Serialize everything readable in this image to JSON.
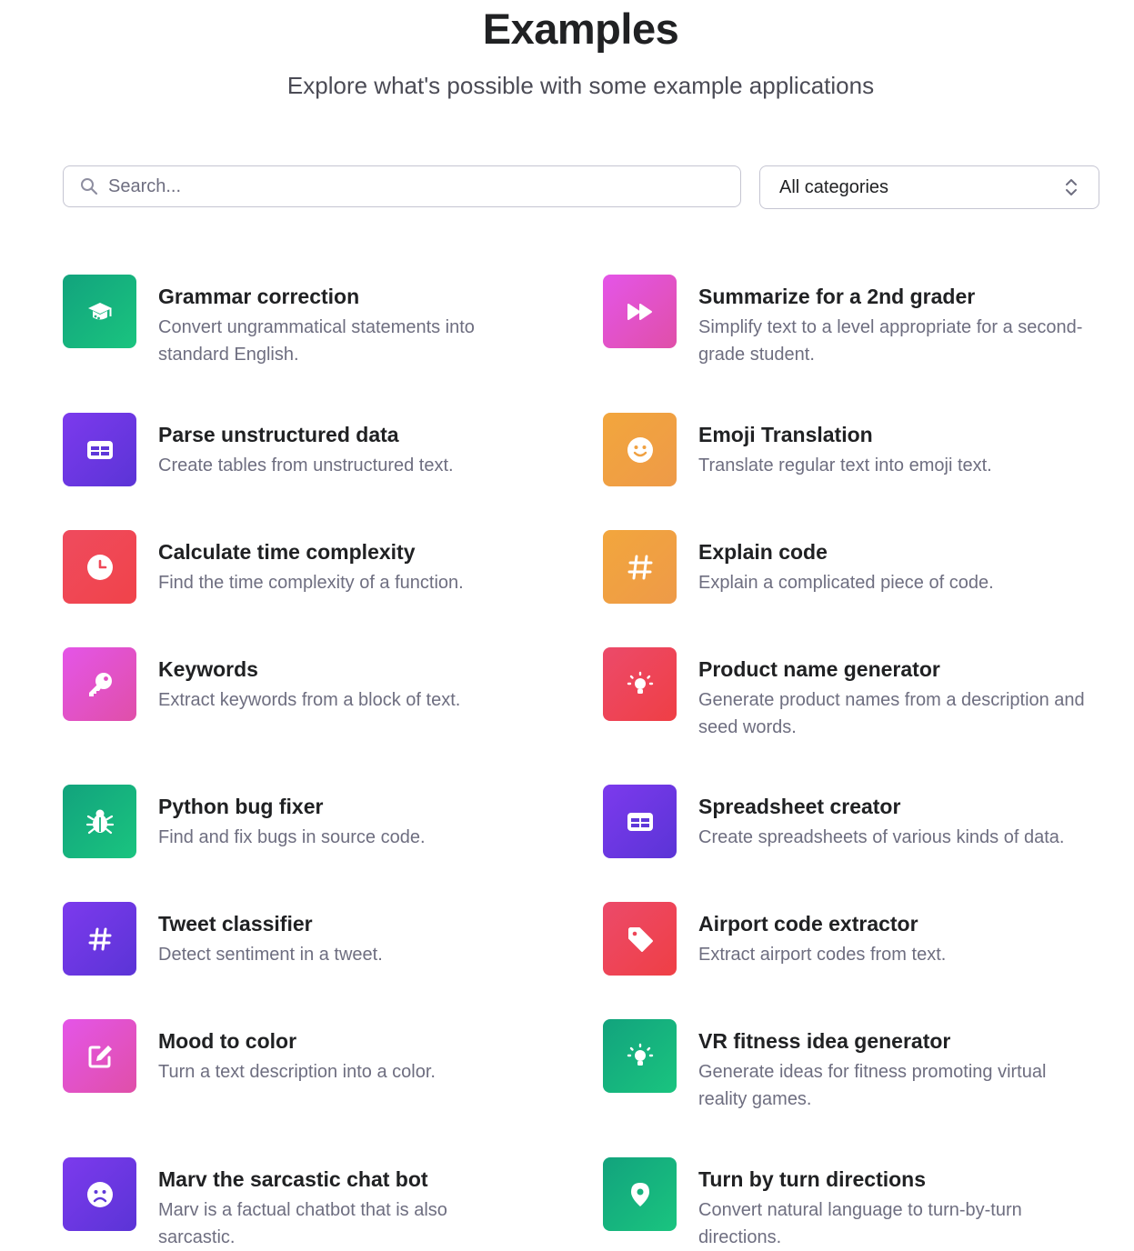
{
  "header": {
    "title": "Examples",
    "subtitle": "Explore what's possible with some example applications"
  },
  "search": {
    "placeholder": "Search...",
    "value": ""
  },
  "category_select": {
    "selected": "All categories"
  },
  "colors": {
    "green": "#1ac47f",
    "pink": "#e455e8",
    "purple": "#5b34d6",
    "orange": "#f2a63d",
    "red": "#f0434a",
    "text_primary": "#202123",
    "text_secondary": "#6e6e80"
  },
  "examples": [
    {
      "title": "Grammar correction",
      "desc": "Convert ungrammatical statements into standard English.",
      "icon": "graduation-cap-icon"
    },
    {
      "title": "Summarize for a 2nd grader",
      "desc": "Simplify text to a level appropriate for a second-grade student.",
      "icon": "fast-forward-icon"
    },
    {
      "title": "Parse unstructured data",
      "desc": "Create tables from unstructured text.",
      "icon": "table-icon"
    },
    {
      "title": "Emoji Translation",
      "desc": "Translate regular text into emoji text.",
      "icon": "smiley-icon"
    },
    {
      "title": "Calculate time complexity",
      "desc": "Find the time complexity of a function.",
      "icon": "clock-icon"
    },
    {
      "title": "Explain code",
      "desc": "Explain a complicated piece of code.",
      "icon": "hashtag-icon"
    },
    {
      "title": "Keywords",
      "desc": "Extract keywords from a block of text.",
      "icon": "key-icon"
    },
    {
      "title": "Product name generator",
      "desc": "Generate product names from a description and seed words.",
      "icon": "lightbulb-icon"
    },
    {
      "title": "Python bug fixer",
      "desc": "Find and fix bugs in source code.",
      "icon": "bug-icon"
    },
    {
      "title": "Spreadsheet creator",
      "desc": "Create spreadsheets of various kinds of data.",
      "icon": "table-icon"
    },
    {
      "title": "Tweet classifier",
      "desc": "Detect sentiment in a tweet.",
      "icon": "hashtag-icon"
    },
    {
      "title": "Airport code extractor",
      "desc": "Extract airport codes from text.",
      "icon": "tag-icon"
    },
    {
      "title": "Mood to color",
      "desc": "Turn a text description into a color.",
      "icon": "edit-icon"
    },
    {
      "title": "VR fitness idea generator",
      "desc": "Generate ideas for fitness promoting virtual reality games.",
      "icon": "lightbulb-icon"
    },
    {
      "title": "Marv the sarcastic chat bot",
      "desc": "Marv is a factual chatbot that is also sarcastic.",
      "icon": "frown-icon"
    },
    {
      "title": "Turn by turn directions",
      "desc": "Convert natural language to turn-by-turn directions.",
      "icon": "map-pin-icon"
    }
  ]
}
